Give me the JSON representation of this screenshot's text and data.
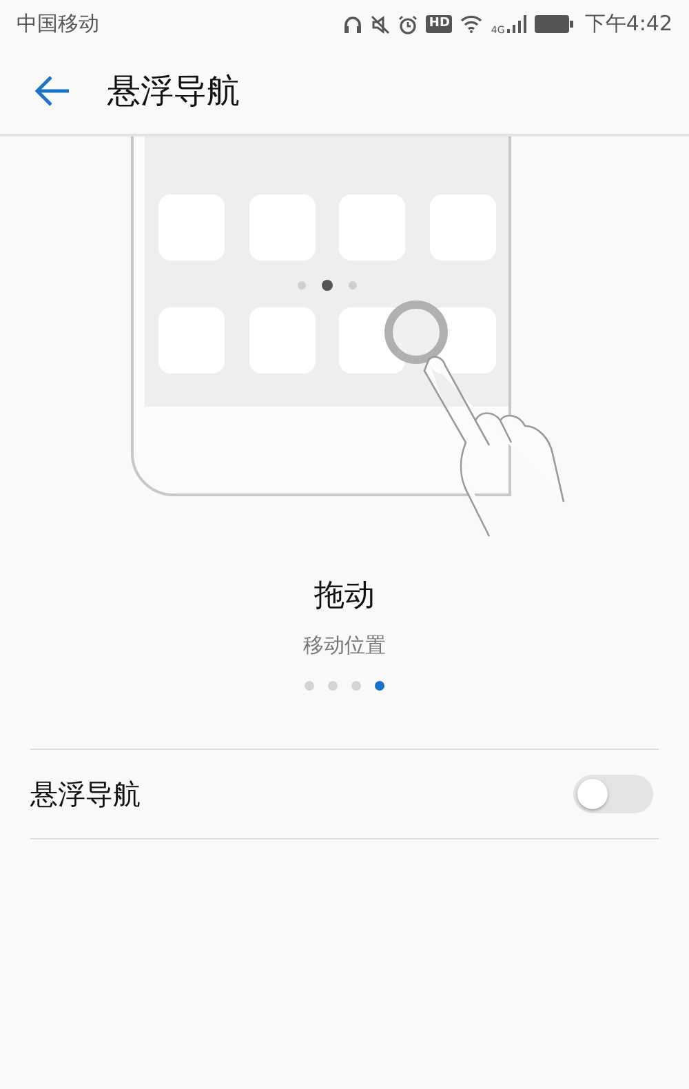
{
  "status_bar": {
    "carrier": "中国移动",
    "hd_badge": "HD",
    "network": "4G",
    "time": "下午4:42"
  },
  "header": {
    "title": "悬浮导航"
  },
  "illustration": {
    "screen_dots": [
      {
        "selected": false
      },
      {
        "selected": true
      },
      {
        "selected": false
      }
    ]
  },
  "slide": {
    "title": "拖动",
    "subtitle": "移动位置"
  },
  "page_dots": [
    {
      "selected": false
    },
    {
      "selected": false
    },
    {
      "selected": false
    },
    {
      "selected": true
    }
  ],
  "setting": {
    "label": "悬浮导航",
    "on": false
  }
}
